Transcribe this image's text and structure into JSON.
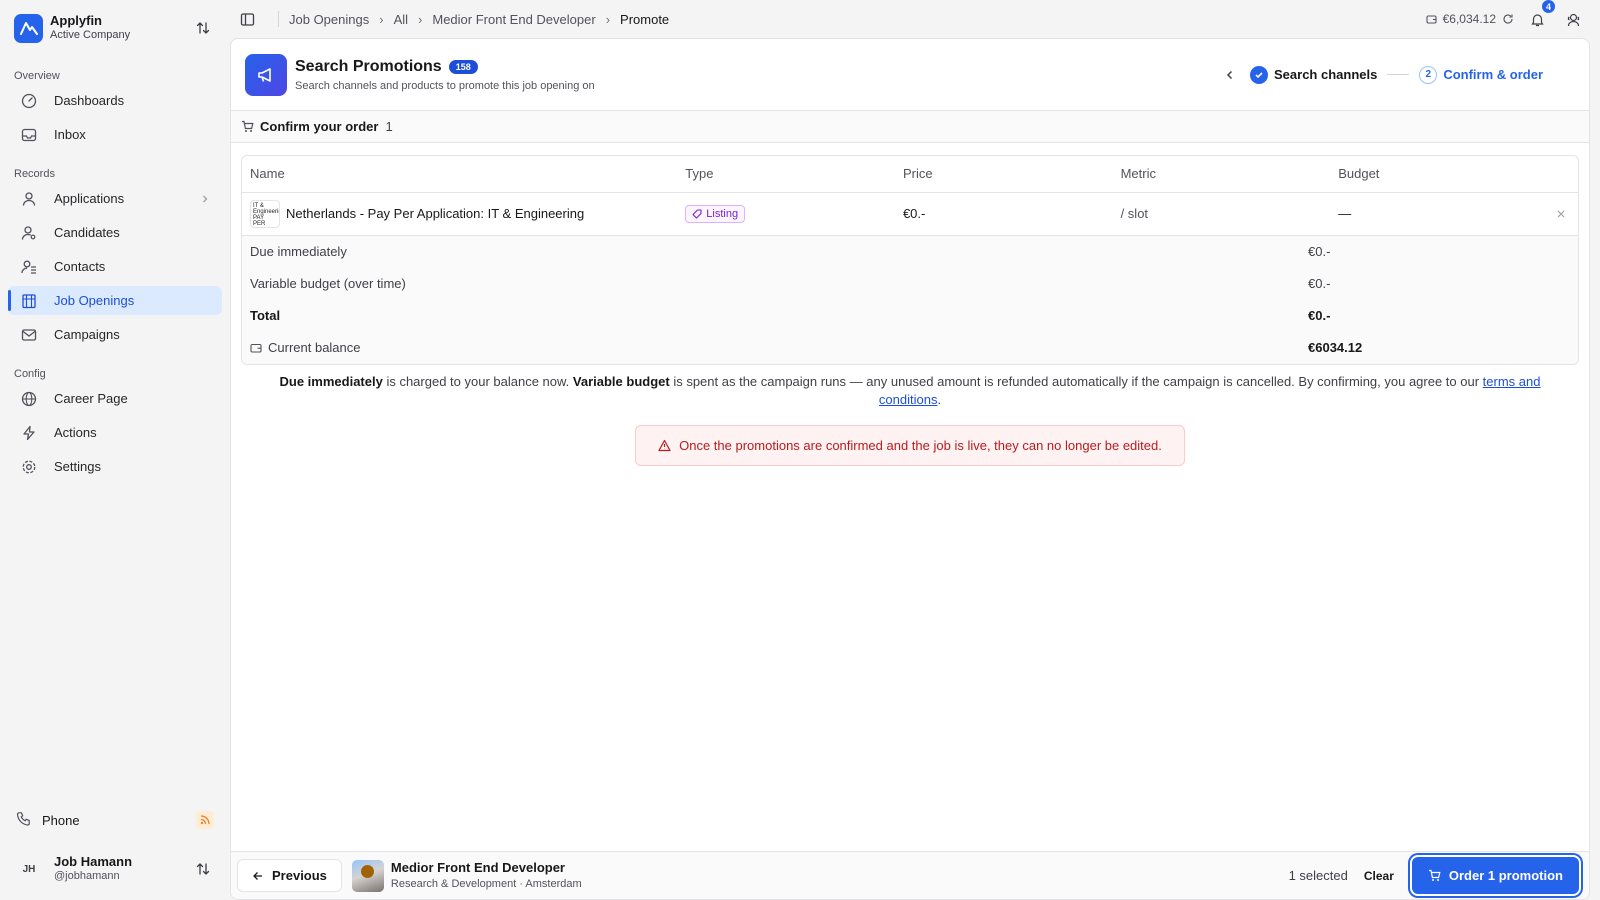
{
  "brand": {
    "name": "Applyfin",
    "subtitle": "Active Company"
  },
  "sidebar": {
    "sections": [
      {
        "label": "Overview",
        "items": [
          {
            "label": "Dashboards",
            "icon": "gauge-icon"
          },
          {
            "label": "Inbox",
            "icon": "inbox-icon"
          }
        ]
      },
      {
        "label": "Records",
        "items": [
          {
            "label": "Applications",
            "icon": "user-icon"
          },
          {
            "label": "Candidates",
            "icon": "user-search-icon"
          },
          {
            "label": "Contacts",
            "icon": "contacts-icon"
          },
          {
            "label": "Job Openings",
            "icon": "building-icon"
          },
          {
            "label": "Campaigns",
            "icon": "mail-icon"
          }
        ]
      },
      {
        "label": "Config",
        "items": [
          {
            "label": "Career Page",
            "icon": "globe-icon"
          },
          {
            "label": "Actions",
            "icon": "bolt-icon"
          },
          {
            "label": "Settings",
            "icon": "gear-icon"
          }
        ]
      }
    ],
    "phone_label": "Phone",
    "user": {
      "initials": "JH",
      "name": "Job Hamann",
      "handle": "@jobhamann"
    }
  },
  "breadcrumb": [
    "Job Openings",
    "All",
    "Medior Front End Developer",
    "Promote"
  ],
  "topbar": {
    "balance": "€6,034.12",
    "notifications": "4"
  },
  "header": {
    "title": "Search Promotions",
    "count": "158",
    "subtitle": "Search channels and products to promote this job opening on",
    "step1": "Search channels",
    "step2_num": "2",
    "step2": "Confirm & order"
  },
  "order": {
    "label": "Confirm your order",
    "count": "1"
  },
  "table": {
    "columns": [
      "Name",
      "Type",
      "Price",
      "Metric",
      "Budget"
    ],
    "rows": [
      {
        "thumb": "IT & Engineering PAY PER APP",
        "name": "Netherlands - Pay Per Application: IT & Engineering",
        "type": "Listing",
        "price": "€0.-",
        "metric": "/ slot",
        "budget": "—"
      }
    ]
  },
  "summary": {
    "due_label": "Due immediately",
    "due_value": "€0.-",
    "variable_label": "Variable budget (over time)",
    "variable_value": "€0.-",
    "total_label": "Total",
    "total_value": "€0.-",
    "balance_label": "Current balance",
    "balance_value": "€6034.12"
  },
  "notice": {
    "b1": "Due immediately",
    "t1": " is charged to your balance now. ",
    "b2": "Variable budget",
    "t2": " is spent as the campaign runs — any unused amount is refunded automatically if the campaign is cancelled. By confirming, you agree to our ",
    "link": "terms and conditions",
    "t3": "."
  },
  "warning": "Once the promotions are confirmed and the job is live, they can no longer be edited.",
  "footer": {
    "previous": "Previous",
    "job_title": "Medior Front End Developer",
    "job_sub": "Research & Development · Amsterdam",
    "selected": "1 selected",
    "clear": "Clear",
    "order_btn": "Order 1 promotion"
  },
  "colors": {
    "accent": "#2563eb",
    "active_bg": "#dbeafe",
    "warning": "#b91c1c",
    "listing": "#7e22ce"
  }
}
